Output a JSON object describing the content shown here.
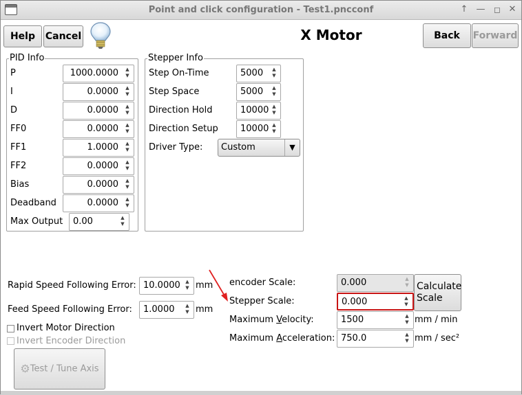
{
  "window": {
    "title": "Point and click configuration - Test1.pncconf"
  },
  "header": {
    "help_label": "Help",
    "cancel_label": "Cancel",
    "page_title": "X Motor",
    "back_label": "Back",
    "forward_label": "Forward"
  },
  "pid": {
    "title": "PID Info",
    "rows": [
      {
        "label": "P",
        "value": "1000.0000"
      },
      {
        "label": "I",
        "value": "0.0000"
      },
      {
        "label": "D",
        "value": "0.0000"
      },
      {
        "label": "FF0",
        "value": "0.0000"
      },
      {
        "label": "FF1",
        "value": "1.0000"
      },
      {
        "label": "FF2",
        "value": "0.0000"
      },
      {
        "label": "Bias",
        "value": "0.0000"
      },
      {
        "label": "Deadband",
        "value": "0.0000"
      },
      {
        "label": "Max Output",
        "value": "0.00"
      }
    ]
  },
  "stepper": {
    "title": "Stepper Info",
    "rows": [
      {
        "label": "Step On-Time",
        "value": "5000"
      },
      {
        "label": "Step Space",
        "value": "5000"
      },
      {
        "label": "Direction Hold",
        "value": "10000"
      },
      {
        "label": "Direction Setup",
        "value": "10000"
      }
    ],
    "driver_label": "Driver Type:",
    "driver_value": "Custom"
  },
  "errors": {
    "rapid_label": "Rapid Speed Following Error:",
    "rapid_value": "10.0000",
    "rapid_unit": "mm",
    "feed_label": "Feed Speed Following Error:",
    "feed_value": "1.0000",
    "feed_unit": "mm"
  },
  "options": {
    "invert_motor": "Invert Motor Direction",
    "invert_encoder": "Invert Encoder Direction"
  },
  "test_button": "Test / Tune Axis",
  "scale": {
    "encoder_label": "encoder Scale:",
    "encoder_value": "0.000",
    "stepper_label": "Stepper Scale:",
    "stepper_value": "0.000",
    "velocity_label_pre": "Maximum ",
    "velocity_label_u": "V",
    "velocity_label_post": "elocity:",
    "velocity_value": "1500",
    "velocity_unit": "mm / min",
    "accel_label_pre": "Maximum ",
    "accel_label_u": "A",
    "accel_label_post": "cceleration:",
    "accel_value": "750.0",
    "accel_unit": "mm / sec²",
    "calculate_label": "Calculate\nScale"
  },
  "colors": {
    "highlight": "#c81414",
    "annotation_arrow": "#e02020"
  }
}
